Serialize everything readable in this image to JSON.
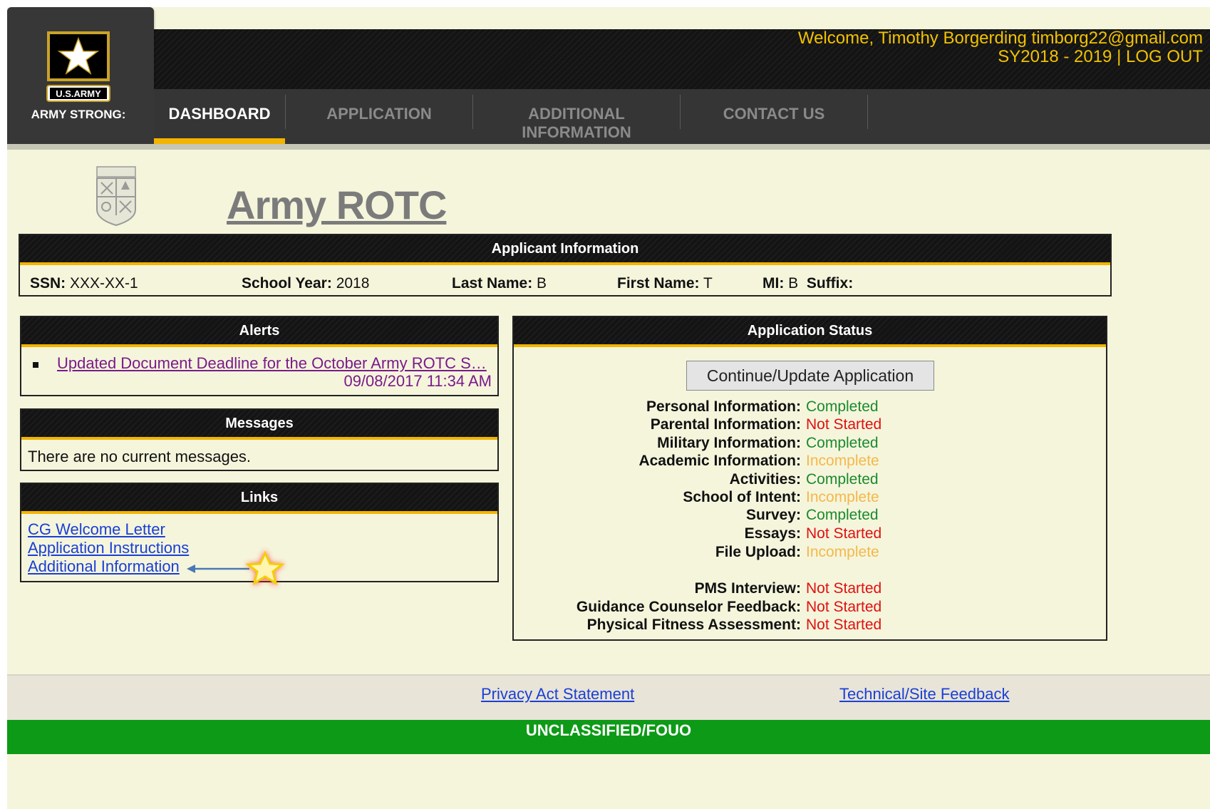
{
  "header": {
    "logo": {
      "badge_text": "U.S.ARMY",
      "tagline": "ARMY STRONG:"
    },
    "welcome_line": "Welcome, Timothy Borgerding timborg22@gmail.com",
    "school_year_label": "SY2018 - 2019 |",
    "logout_label": "LOG OUT"
  },
  "nav": {
    "dashboard": "DASHBOARD",
    "application": "APPLICATION",
    "additional_line1": "ADDITIONAL",
    "additional_line2": "INFORMATION",
    "contact": "CONTACT US"
  },
  "page_title": "Army ROTC",
  "applicant": {
    "title": "Applicant Information",
    "ssn_label": "SSN:",
    "ssn": "XXX-XX-1",
    "school_year_label": "School Year:",
    "school_year": "2018",
    "last_name_label": "Last Name:",
    "last_name": "B",
    "first_name_label": "First Name:",
    "first_name": "T",
    "mi_label": "MI:",
    "mi": "B",
    "suffix_label": "Suffix:",
    "suffix": ""
  },
  "alerts": {
    "title": "Alerts",
    "items": [
      {
        "text": "Updated Document Deadline for the October Army ROTC S…",
        "date": "09/08/2017 11:34 AM"
      }
    ]
  },
  "messages": {
    "title": "Messages",
    "text": "There are no current messages."
  },
  "links": {
    "title": "Links",
    "items": [
      "CG Welcome Letter",
      "Application Instructions",
      "Additional Information"
    ]
  },
  "status": {
    "title": "Application Status",
    "button_label": "Continue/Update Application",
    "items": [
      {
        "label": "Personal Information:",
        "value": "Completed",
        "color": "#1a8a2e"
      },
      {
        "label": "Parental Information:",
        "value": "Not Started",
        "color": "#e01010"
      },
      {
        "label": "Military Information:",
        "value": "Completed",
        "color": "#1a8a2e"
      },
      {
        "label": "Academic Information:",
        "value": "Incomplete",
        "color": "#f5b84a"
      },
      {
        "label": "Activities:",
        "value": "Completed",
        "color": "#1a8a2e"
      },
      {
        "label": "School of Intent:",
        "value": "Incomplete",
        "color": "#f5b84a"
      },
      {
        "label": "Survey:",
        "value": "Completed",
        "color": "#1a8a2e"
      },
      {
        "label": "Essays:",
        "value": "Not Started",
        "color": "#e01010"
      },
      {
        "label": "File Upload:",
        "value": "Incomplete",
        "color": "#f5b84a"
      },
      {
        "label": "PMS Interview:",
        "value": "Not Started",
        "color": "#e01010"
      },
      {
        "label": "Guidance Counselor Feedback:",
        "value": "Not Started",
        "color": "#e01010"
      },
      {
        "label": "Physical Fitness Assessment:",
        "value": "Not Started",
        "color": "#e01010"
      }
    ]
  },
  "footer": {
    "privacy": "Privacy Act Statement",
    "feedback": "Technical/Site Feedback",
    "classification": "UNCLASSIFIED/FOUO"
  },
  "colors": {
    "accent": "#f2b400",
    "header_text": "#f2c200",
    "classification_bg": "#0d9a16"
  }
}
